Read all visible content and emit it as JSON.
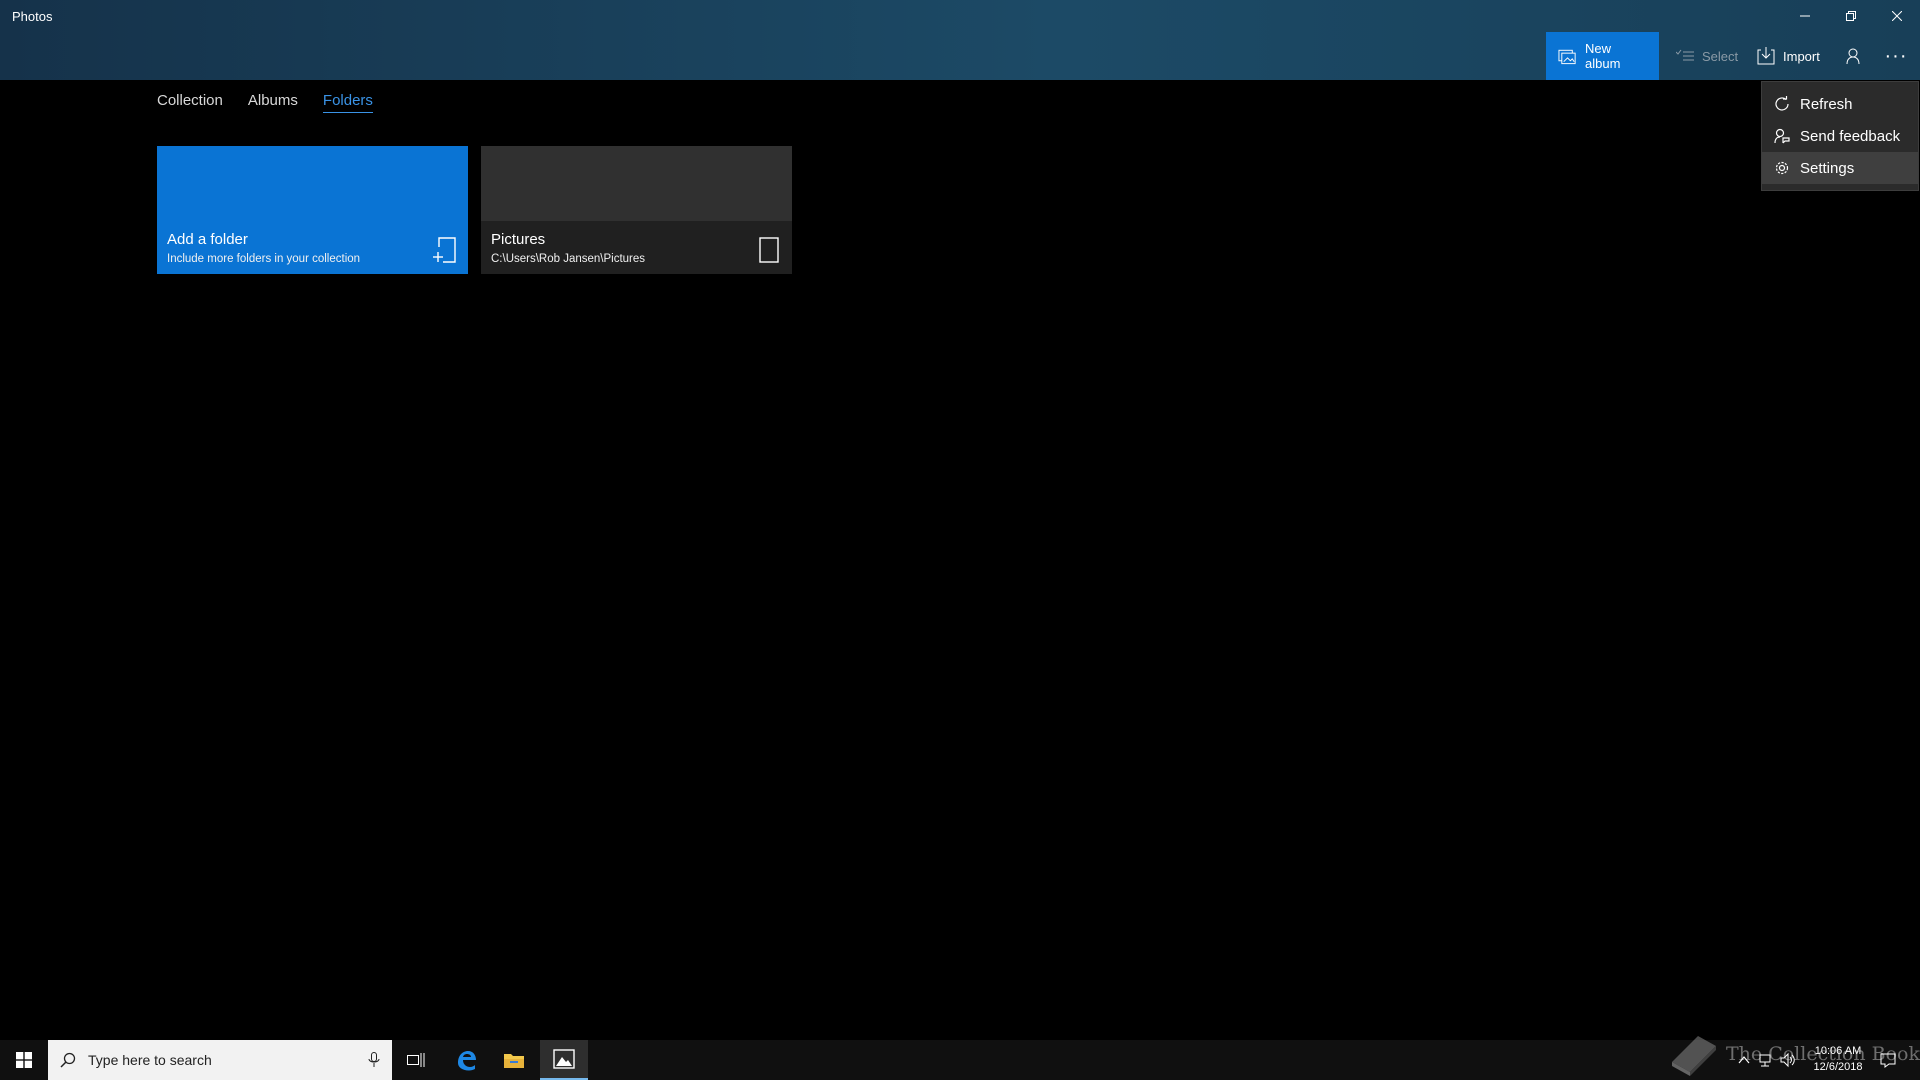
{
  "window": {
    "title": "Photos",
    "controls": {
      "minimize": "minimize-icon",
      "restore": "restore-icon",
      "close": "close-icon"
    }
  },
  "toolbar": {
    "new_album": "New album",
    "select": "Select",
    "import": "Import",
    "account_icon": "person-icon",
    "more_icon": "more-icon"
  },
  "tabs": [
    {
      "label": "Collection",
      "active": false
    },
    {
      "label": "Albums",
      "active": false
    },
    {
      "label": "Folders",
      "active": true
    }
  ],
  "folders": {
    "add": {
      "title": "Add a folder",
      "subtitle": "Include more folders in your collection"
    },
    "pictures": {
      "title": "Pictures",
      "path": "C:\\Users\\Rob Jansen\\Pictures"
    }
  },
  "menu": {
    "items": [
      {
        "label": "Refresh",
        "icon": "refresh-icon"
      },
      {
        "label": "Send feedback",
        "icon": "feedback-icon"
      },
      {
        "label": "Settings",
        "icon": "gear-icon"
      }
    ]
  },
  "taskbar": {
    "search_placeholder": "Type here to search",
    "apps": [
      "task-view-icon",
      "edge-icon",
      "file-explorer-icon",
      "photos-icon"
    ],
    "clock": {
      "time": "10:06 AM",
      "date": "12/6/2018"
    },
    "watermark": "The Collection Book"
  },
  "colors": {
    "accent": "#0a74d4",
    "active_tab": "#3a93e6",
    "background": "#000000",
    "titlebar": "#1c4a66"
  }
}
